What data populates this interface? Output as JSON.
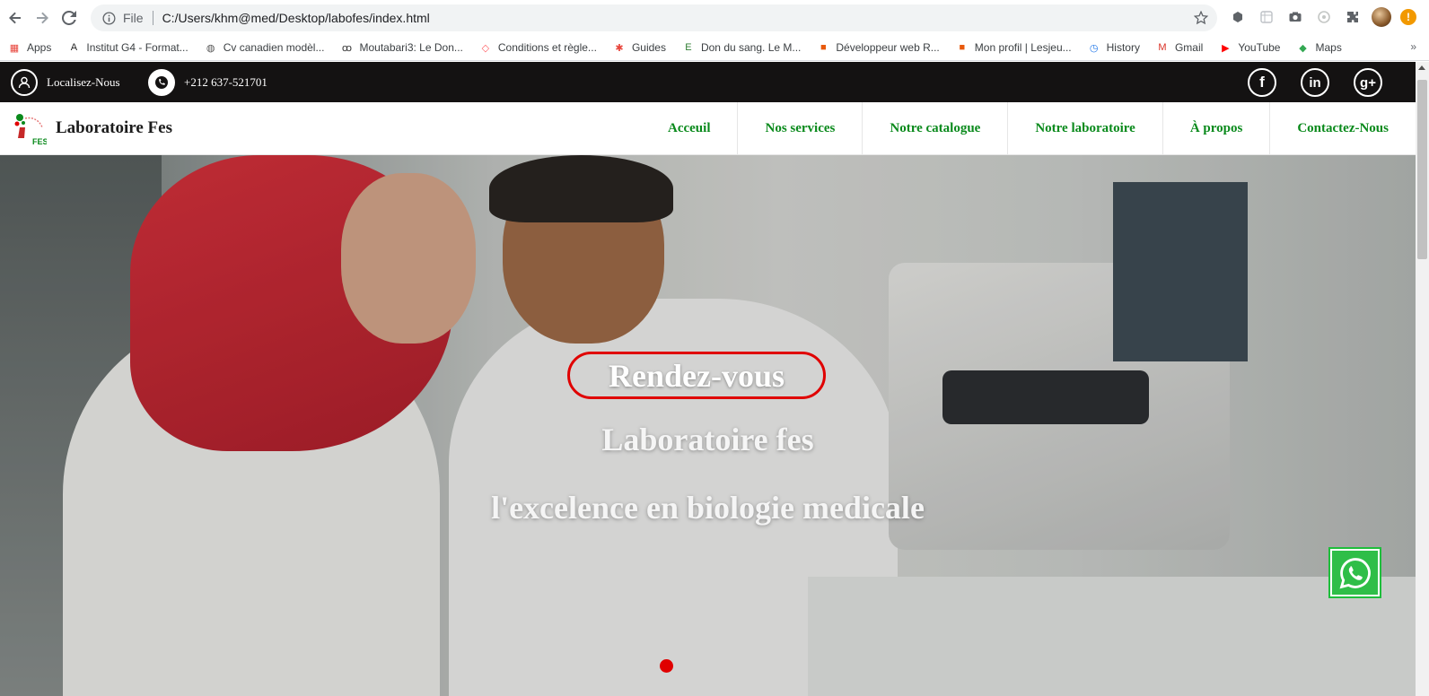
{
  "browser": {
    "scheme": "File",
    "url": "C:/Users/khm@med/Desktop/labofes/index.html",
    "bookmarks": [
      {
        "label": "Apps",
        "icon": "apps-grid-icon",
        "color": "#e8453c"
      },
      {
        "label": "Institut G4 - Format...",
        "icon": "g4-icon",
        "color": "#222222"
      },
      {
        "label": "Cv canadien modèl...",
        "icon": "globe-icon",
        "color": "#555555"
      },
      {
        "label": "Moutabari3: Le Don...",
        "icon": "people-icon",
        "color": "#333333"
      },
      {
        "label": "Conditions et règle...",
        "icon": "airbnb-icon",
        "color": "#ff5a5f"
      },
      {
        "label": "Guides",
        "icon": "guides-icon",
        "color": "#e8453c"
      },
      {
        "label": "Don du sang. Le M...",
        "icon": "letter-e-icon",
        "color": "#2e7d32"
      },
      {
        "label": "Développeur web R...",
        "icon": "lesjeudis-icon",
        "color": "#e8590c"
      },
      {
        "label": "Mon profil | Lesjeu...",
        "icon": "lesjeudis-icon",
        "color": "#e8590c"
      },
      {
        "label": "History",
        "icon": "history-icon",
        "color": "#1a73e8"
      },
      {
        "label": "Gmail",
        "icon": "gmail-icon",
        "color": "#d93025"
      },
      {
        "label": "YouTube",
        "icon": "youtube-icon",
        "color": "#ff0000"
      },
      {
        "label": "Maps",
        "icon": "maps-icon",
        "color": "#34a853"
      }
    ],
    "bookmarks_more": "»"
  },
  "topbar": {
    "location_label": "Localisez-Nous",
    "phone": "+212 637-521701",
    "social": [
      {
        "label": "f",
        "icon": "facebook-icon"
      },
      {
        "label": "in",
        "icon": "linkedin-icon"
      },
      {
        "label": "g+",
        "icon": "google-plus-icon"
      }
    ]
  },
  "nav": {
    "brand": "Laboratoire Fes",
    "logo_text": "FES",
    "items": [
      "Acceuil",
      "Nos services",
      "Notre catalogue",
      "Notre laboratoire",
      "À propos",
      "Contactez-Nous"
    ]
  },
  "hero": {
    "cta_label": "Rendez-vous",
    "line1": "Laboratoire fes",
    "line2": "l'excelence en biologie medicale"
  },
  "colors": {
    "accent_green": "#0a8a1c",
    "accent_red": "#e00000",
    "topbar_bg": "#141212",
    "whatsapp": "#2fbe48"
  }
}
